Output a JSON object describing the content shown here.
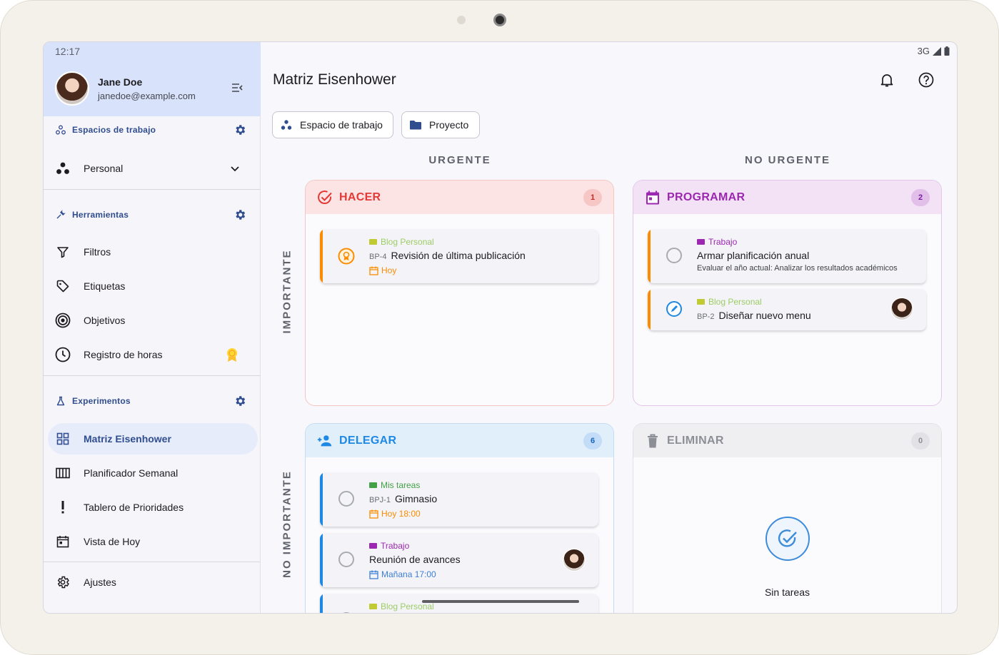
{
  "status": {
    "time": "12:17",
    "network": "3G"
  },
  "user": {
    "name": "Jane Doe",
    "email": "janedoe@example.com"
  },
  "sidebar": {
    "workspaces_header": "Espacios de trabajo",
    "workspace_selected": "Personal",
    "tools_header": "Herramientas",
    "tools": [
      {
        "label": "Filtros",
        "icon": "filter-icon"
      },
      {
        "label": "Etiquetas",
        "icon": "tag-icon"
      },
      {
        "label": "Objetivos",
        "icon": "target-icon"
      },
      {
        "label": "Registro de horas",
        "icon": "clock-icon"
      }
    ],
    "experiments_header": "Experimentos",
    "experiments": [
      {
        "label": "Matriz Eisenhower",
        "icon": "grid-icon",
        "active": true
      },
      {
        "label": "Planificador Semanal",
        "icon": "columns-icon"
      },
      {
        "label": "Tablero de Prioridades",
        "icon": "exclamation-icon"
      },
      {
        "label": "Vista de Hoy",
        "icon": "calendar-icon"
      }
    ],
    "settings": "Ajustes"
  },
  "main": {
    "title": "Matriz Eisenhower",
    "chips": {
      "workspace": "Espacio de trabajo",
      "project": "Proyecto"
    },
    "columns": {
      "urgent": "URGENTE",
      "not_urgent": "NO URGENTE"
    },
    "rows": {
      "important": "IMPORTANTE",
      "not_important": "NO IMPORTANTE"
    },
    "quadrants": {
      "do": {
        "title": "HACER",
        "count": "1",
        "color": "#e53935",
        "tasks": [
          {
            "project": "Blog Personal",
            "code": "BP-4",
            "title": "Revisión de última publicación",
            "date": "Hoy"
          }
        ]
      },
      "schedule": {
        "title": "PROGRAMAR",
        "count": "2",
        "color": "#9c27b0",
        "tasks": [
          {
            "project": "Trabajo",
            "title": "Armar planificación anual",
            "subtitle": "Evaluar el año actual: Analizar los resultados académicos"
          },
          {
            "project": "Blog Personal",
            "code": "BP-2",
            "title": "Diseñar nuevo menu"
          }
        ]
      },
      "delegate": {
        "title": "DELEGAR",
        "count": "6",
        "color": "#1e88e5",
        "tasks": [
          {
            "project": "Mis tareas",
            "code": "BPJ-1",
            "title": "Gimnasio",
            "date": "Hoy 18:00"
          },
          {
            "project": "Trabajo",
            "title": "Reunión de avances",
            "date": "Mañana 17:00"
          },
          {
            "project": "Blog Personal"
          }
        ]
      },
      "eliminate": {
        "title": "ELIMINAR",
        "count": "0",
        "empty": "Sin tareas"
      }
    }
  }
}
